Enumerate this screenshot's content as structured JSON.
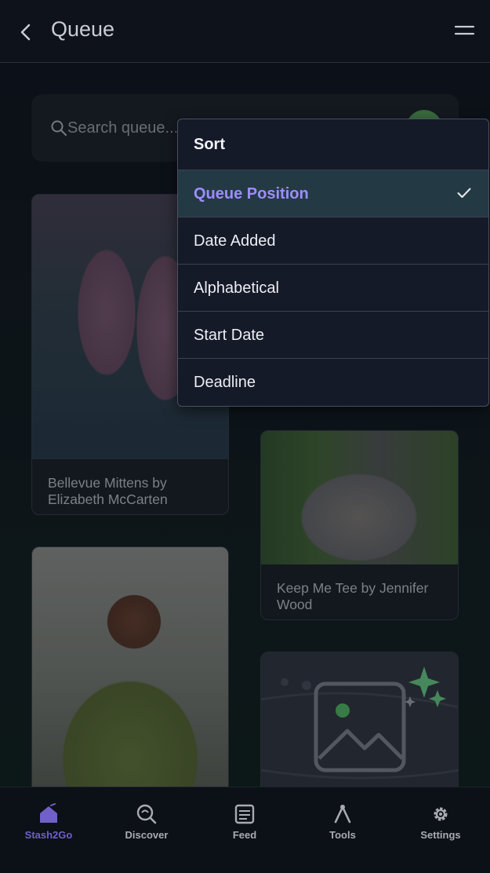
{
  "header": {
    "title": "Queue"
  },
  "search": {
    "placeholder": "Search queue..."
  },
  "cards": [
    {
      "label": "Bellevue Mittens by Elizabeth McCarten"
    },
    {
      "label": "Keep Me Tee by Jennifer Wood"
    }
  ],
  "sort_menu": {
    "title": "Sort",
    "options": [
      "Queue Position",
      "Date Added",
      "Alphabetical",
      "Start Date",
      "Deadline"
    ],
    "selected": "Queue Position"
  },
  "bottom_nav": {
    "items": [
      "Stash2Go",
      "Discover",
      "Feed",
      "Tools",
      "Settings"
    ],
    "active": "Stash2Go"
  },
  "colors": {
    "accent": "#7060c8",
    "selected_text": "#9f8cff",
    "selected_bg": "#233a44"
  }
}
